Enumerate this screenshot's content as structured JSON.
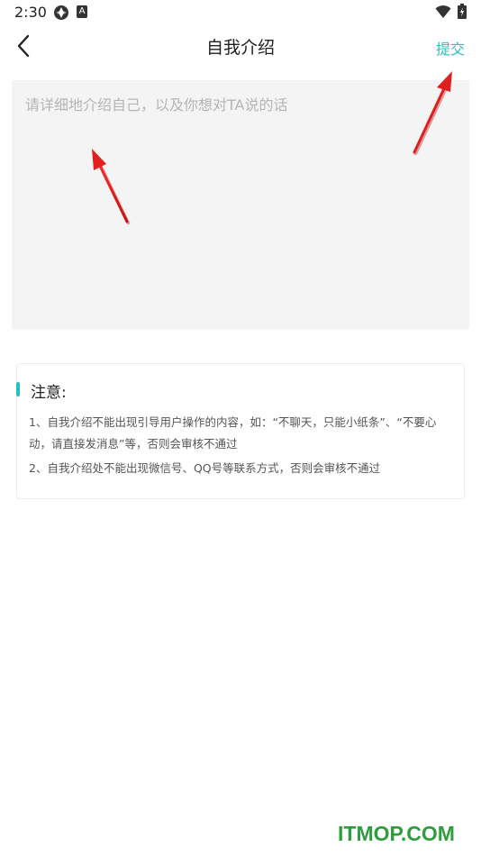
{
  "status_bar": {
    "time": "2:30",
    "app_icon_2_letter": "A",
    "icons": [
      "app-icon",
      "accessibility-icon",
      "wifi-icon",
      "battery-icon"
    ]
  },
  "header": {
    "title": "自我介绍",
    "submit_label": "提交",
    "back_icon": "chevron-left-icon"
  },
  "intro": {
    "value": "",
    "placeholder": "请详细地介绍自己，以及你想对TA说的话"
  },
  "notice": {
    "title": "注意:",
    "items": [
      "1、自我介绍不能出现引导用户操作的内容，如：“不聊天，只能小纸条”、“不要心动，请直接发消息”等，否则会审核不通过",
      "2、自我介绍处不能出现微信号、QQ号等联系方式，否则会审核不通过"
    ]
  },
  "watermark": "ITMOP.COM",
  "colors": {
    "accent": "#2bbdc0",
    "textarea_bg": "#f4f4f4",
    "placeholder": "#b5b5b5",
    "arrow": "#e02020",
    "watermark": "#2e9e3c"
  }
}
